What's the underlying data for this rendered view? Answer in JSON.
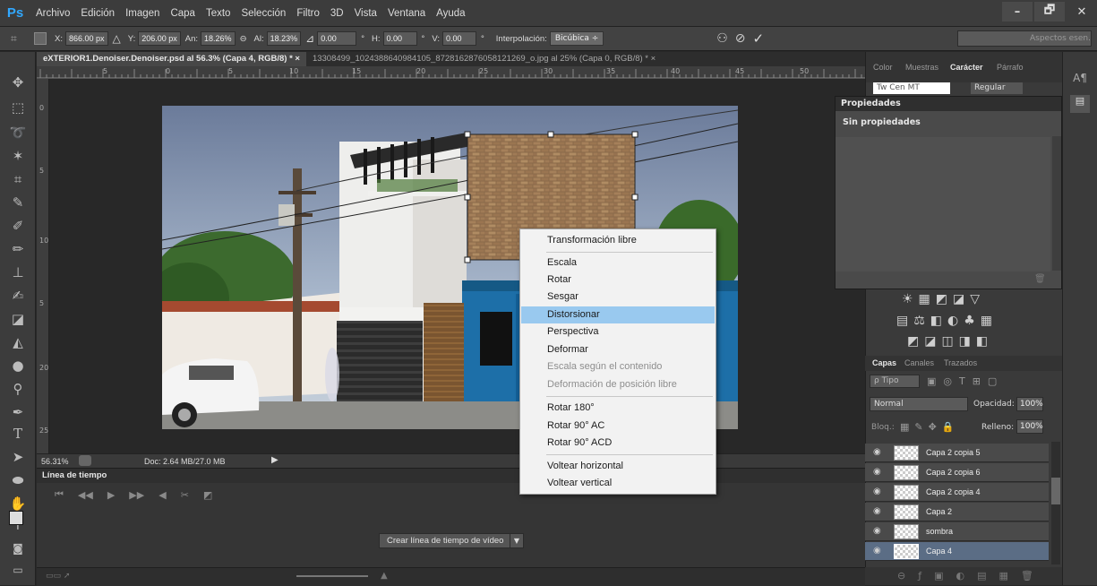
{
  "app": {
    "logo": "Ps"
  },
  "menu": [
    "Archivo",
    "Edición",
    "Imagen",
    "Capa",
    "Texto",
    "Selección",
    "Filtro",
    "3D",
    "Vista",
    "Ventana",
    "Ayuda"
  ],
  "window_controls": {
    "minimize": "–",
    "maximize": "🗗",
    "close": "✕"
  },
  "options": {
    "x_label": "X:",
    "x_value": "866.00 px",
    "y_label": "Y:",
    "y_value": "206.00 px",
    "w_label": "An:",
    "w_value": "18.26%",
    "h_label": "Al:",
    "h_value": "18.23%",
    "angle_value": "0.00",
    "hskew_label": "H:",
    "hskew_value": "0.00",
    "vskew_label": "V:",
    "vskew_value": "0.00",
    "interp_label": "Interpolación:",
    "interp_value": "Bicúbica ÷",
    "workspace": "Aspectos esen."
  },
  "doc_tabs": [
    {
      "label": "eXTERIOR1.Denoiser.Denoiser.psd al 56.3% (Capa 4, RGB/8) * ×",
      "active": true
    },
    {
      "label": "13308499_1024388640984105_8728162876058121269_o.jpg al 25% (Capa 0, RGB/8) * ×",
      "active": false
    }
  ],
  "ruler_labels": [
    "5",
    "0",
    "5",
    "10",
    "15",
    "20",
    "25",
    "30",
    "35",
    "40",
    "45",
    "50"
  ],
  "status": {
    "zoom": "56.31%",
    "doc": "Doc: 2.64 MB/27.0 MB"
  },
  "timeline": {
    "title": "Línea de tiempo",
    "create_button": "Crear línea de tiempo de vídeo"
  },
  "context_menu": [
    {
      "label": "Transformación libre",
      "state": "normal"
    },
    {
      "label": "Escala",
      "state": "normal"
    },
    {
      "label": "Rotar",
      "state": "normal"
    },
    {
      "label": "Sesgar",
      "state": "normal"
    },
    {
      "label": "Distorsionar",
      "state": "selected"
    },
    {
      "label": "Perspectiva",
      "state": "normal"
    },
    {
      "label": "Deformar",
      "state": "normal"
    },
    {
      "label": "Escala según el contenido",
      "state": "disabled"
    },
    {
      "label": "Deformación de posición libre",
      "state": "disabled"
    },
    {
      "label": "Rotar 180°",
      "state": "normal"
    },
    {
      "label": "Rotar 90° AC",
      "state": "normal"
    },
    {
      "label": "Rotar 90° ACD",
      "state": "normal"
    },
    {
      "label": "Voltear horizontal",
      "state": "normal"
    },
    {
      "label": "Voltear vertical",
      "state": "normal"
    }
  ],
  "char_panel": {
    "tabs": [
      "Color",
      "Muestras",
      "Carácter",
      "Párrafo"
    ],
    "font": "Tw Cen MT",
    "style": "Regular"
  },
  "properties": {
    "title": "Propiedades",
    "subtitle": "Sin propiedades"
  },
  "layers_panel": {
    "tabs": [
      "Capas",
      "Canales",
      "Trazados"
    ],
    "filter": "ρ Tipo",
    "blend_mode": "Normal",
    "opacity_label": "Opacidad:",
    "opacity_value": "100%",
    "lock_label": "Bloq.:",
    "fill_label": "Relleno:",
    "fill_value": "100%",
    "layers": [
      {
        "name": "Capa 2 copia 5",
        "selected": false
      },
      {
        "name": "Capa 2 copia 6",
        "selected": false
      },
      {
        "name": "Capa 2 copia 4",
        "selected": false
      },
      {
        "name": "Capa 2",
        "selected": false
      },
      {
        "name": "sombra",
        "selected": false
      },
      {
        "name": "Capa 4",
        "selected": true
      }
    ]
  }
}
